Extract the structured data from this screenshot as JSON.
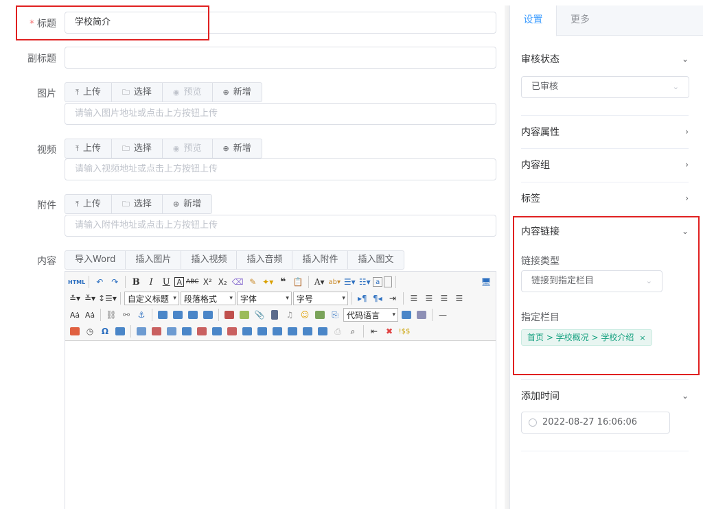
{
  "form": {
    "title": {
      "label": "标题",
      "required_mark": "*",
      "value": "学校简介"
    },
    "subtitle": {
      "label": "副标题",
      "value": ""
    },
    "image": {
      "label": "图片",
      "buttons": [
        "上传",
        "选择",
        "预览",
        "新增"
      ],
      "placeholder": "请输入图片地址或点击上方按钮上传"
    },
    "video": {
      "label": "视频",
      "buttons": [
        "上传",
        "选择",
        "预览",
        "新增"
      ],
      "placeholder": "请输入视频地址或点击上方按钮上传"
    },
    "attachment": {
      "label": "附件",
      "buttons": [
        "上传",
        "选择",
        "新增"
      ],
      "placeholder": "请输入附件地址或点击上方按钮上传"
    },
    "content": {
      "label": "内容",
      "tabs": [
        "导入Word",
        "插入图片",
        "插入视频",
        "插入音频",
        "插入附件",
        "插入图文"
      ],
      "toolbar": {
        "heading_select": "自定义标题",
        "paragraph_select": "段落格式",
        "font_select": "字体",
        "size_select": "字号",
        "code_select": "代码语言",
        "html_icon": "HTML"
      }
    }
  },
  "panel": {
    "tabs": [
      "设置",
      "更多"
    ],
    "review": {
      "title": "审核状态",
      "value": "已审核"
    },
    "attributes": {
      "title": "内容属性"
    },
    "group": {
      "title": "内容组"
    },
    "tags": {
      "title": "标签"
    },
    "link": {
      "title": "内容链接",
      "type_label": "链接类型",
      "type_value": "链接到指定栏目",
      "column_label": "指定栏目",
      "column_tag": "首页 > 学校概况 > 学校介绍",
      "tag_close": "×"
    },
    "add_time": {
      "title": "添加时间",
      "value": "2022-08-27 16:06:06"
    }
  },
  "colors": {
    "accent": "#409eff",
    "highlight_box": "#e02020",
    "tag_text": "#13a07e"
  }
}
